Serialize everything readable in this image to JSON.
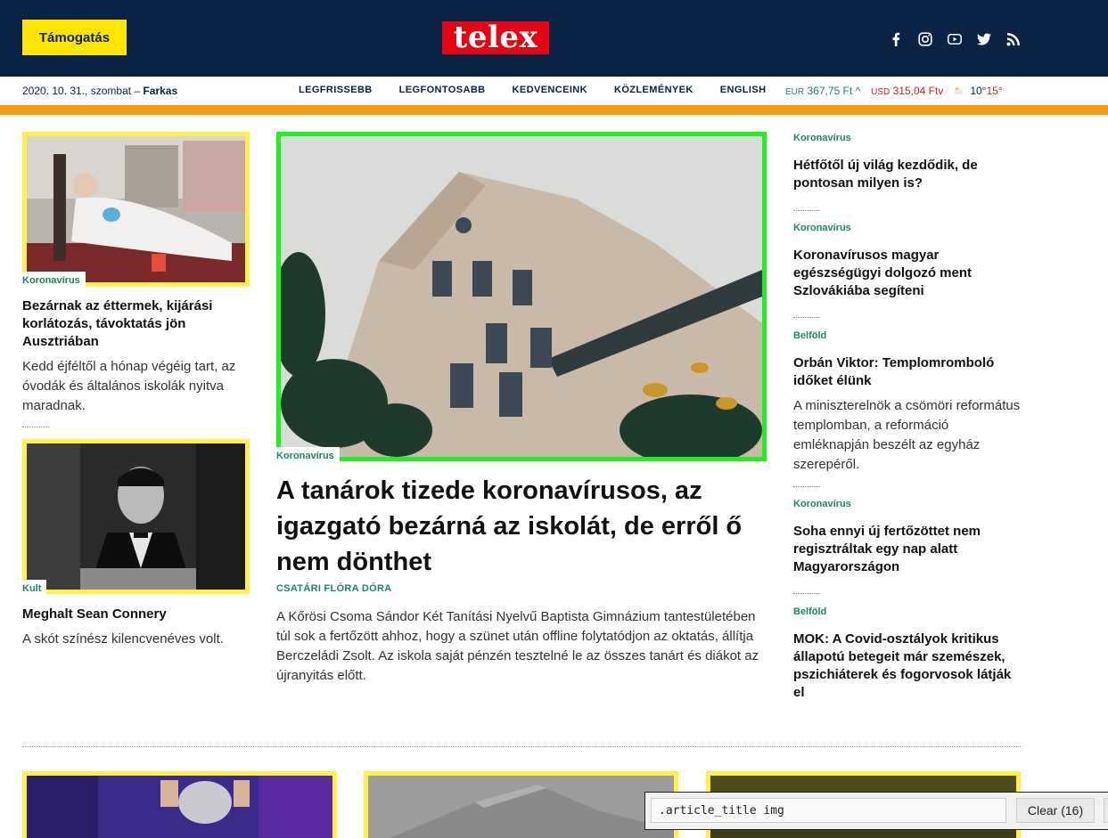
{
  "header": {
    "support_label": "Támogatás",
    "logo_text": "telex",
    "social": [
      "facebook-icon",
      "instagram-icon",
      "youtube-icon",
      "twitter-icon",
      "rss-icon"
    ]
  },
  "subnav": {
    "date": "2020. 10. 31., szombat",
    "name_day": "Farkas",
    "links": [
      "LEGFRISSEBB",
      "LEGFONTOSABB",
      "KEDVENCEINK",
      "KÖZLEMÉNYEK",
      "ENGLISH"
    ],
    "eur_label": "EUR",
    "eur_value": "367,75 Ft",
    "usd_label": "USD",
    "usd_value": "315,04 Ft",
    "temp_low": "10°",
    "temp_high": "15°"
  },
  "left": {
    "a1": {
      "tag": "Koronavírus",
      "title": "Bezárnak az éttermek, kijárási korlátozás, távoktatás jön Ausztriában",
      "lead": "Kedd éjféltől a hónap végéig tart, az óvodák és általános iskolák nyitva maradnak."
    },
    "a2": {
      "tag": "Kult",
      "title": "Meghalt Sean Connery",
      "lead": "A skót színész kilencvenéves volt."
    }
  },
  "main": {
    "tag": "Koronavírus",
    "title": "A tanárok tizede koronavírusos, az igazgató bezárná az iskolát, de erről ő nem dönthet",
    "author": "CSATÁRI FLÓRA DÓRA",
    "lead": "A Kőrösi Csoma Sándor Két Tanítási Nyelvű Baptista Gimnázium tantestületében túl sok a fertőzött ahhoz, hogy a szünet után offline folytatódjon az oktatás, állítja Berczeládi Zsolt. Az iskola saját pénzén tesztelné le az összes tanárt és diákot az újranyitás előtt."
  },
  "right": [
    {
      "tag": "Koronavírus",
      "title": "Hétfőtől új világ kezdődik, de pontosan milyen is?"
    },
    {
      "tag": "Koronavírus",
      "title": "Koronavírusos magyar egészségügyi dolgozó ment Szlovákiába segíteni"
    },
    {
      "tag": "Belföld",
      "title": "Orbán Viktor: Templomromboló időket élünk",
      "lead": "A miniszterelnök a csömöri református templomban, a reformáció emléknapján beszélt az egyház szerepéről."
    },
    {
      "tag": "Koronavírus",
      "title": "Soha ennyi új fertőzöttet nem regisztráltak egy nap alatt Magyarországon"
    },
    {
      "tag": "Belföld",
      "title": "MOK: A Covid-osztályok kritikus állapotú betegeit már szemészek, pszichiáterek és fogorvosok látják el"
    }
  ],
  "devtool": {
    "query": ".article_title img",
    "clear_label": "Clear (16)"
  },
  "colors": {
    "navy": "#0a2344",
    "yellow": "#ffe500",
    "red": "#e40613",
    "orange": "#f39c12",
    "green": "#1a8a5a",
    "highlight_yellow": "#fff04c",
    "highlight_green": "#22ee22"
  }
}
